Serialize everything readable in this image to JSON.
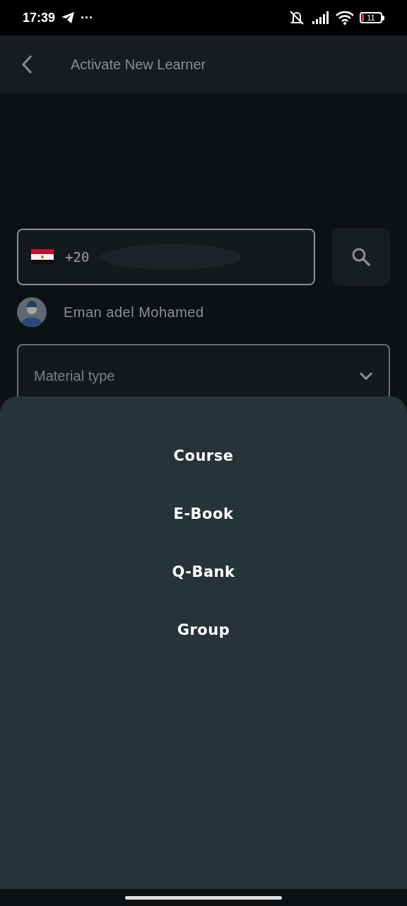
{
  "status_bar": {
    "time": "17:39",
    "more": "···",
    "battery": "11"
  },
  "app_bar": {
    "title": "Activate New Learner"
  },
  "phone": {
    "country_code": "+20"
  },
  "learner": {
    "name": "Eman adel Mohamed"
  },
  "material_select": {
    "placeholder": "Material type"
  },
  "sheet": {
    "options": [
      {
        "label": "Course"
      },
      {
        "label": "E-Book"
      },
      {
        "label": "Q-Bank"
      },
      {
        "label": "Group"
      }
    ]
  }
}
